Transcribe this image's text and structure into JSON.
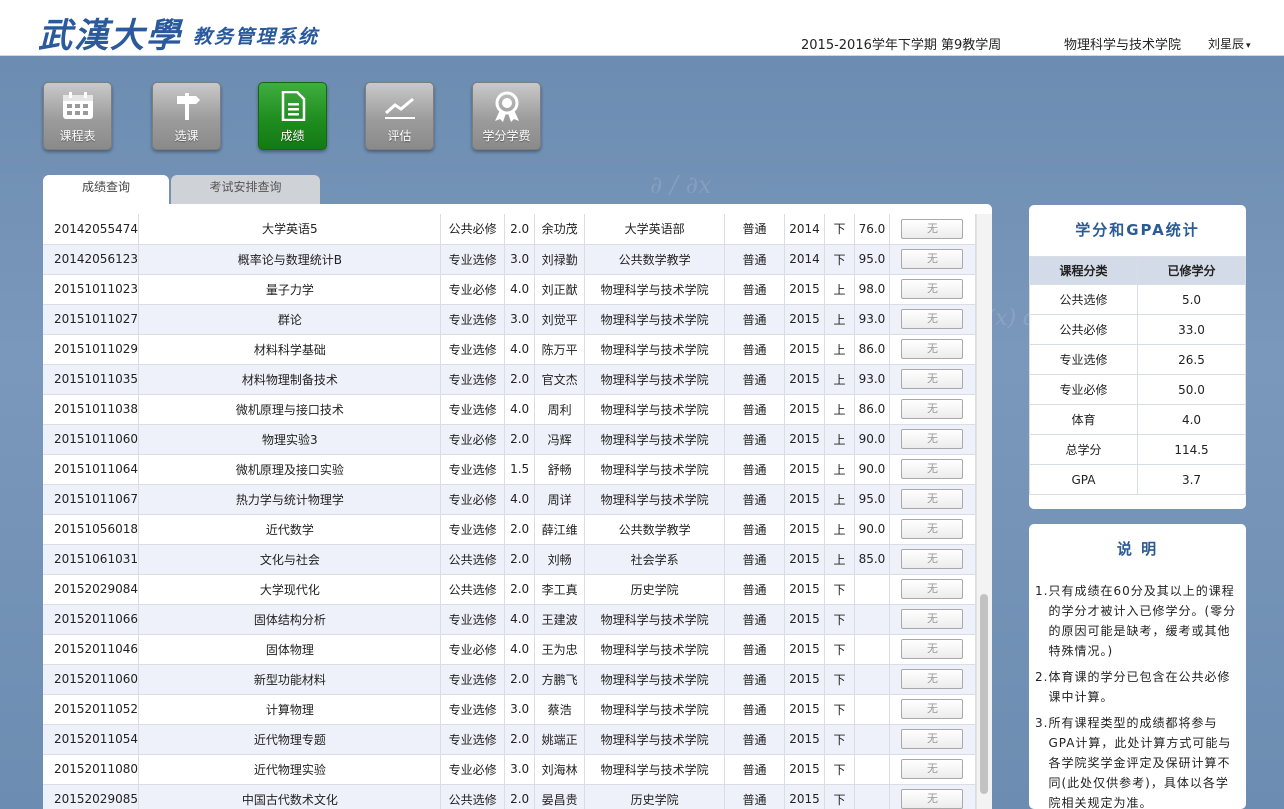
{
  "header": {
    "logo_main": "武漢大學",
    "logo_sub": "教务管理系统",
    "term": "2015-2016学年下学期 第9教学周",
    "college": "物理科学与技术学院",
    "user": "刘星辰",
    "user_caret": "▾"
  },
  "nav": [
    {
      "label": "课程表",
      "icon": "calendar-icon",
      "active": false
    },
    {
      "label": "选课",
      "icon": "signpost-icon",
      "active": false
    },
    {
      "label": "成绩",
      "icon": "document-icon",
      "active": true
    },
    {
      "label": "评估",
      "icon": "chart-line-icon",
      "active": false
    },
    {
      "label": "学分学费",
      "icon": "award-ribbon-icon",
      "active": false
    }
  ],
  "tabs": [
    {
      "label": "成绩查询",
      "active": true
    },
    {
      "label": "考试安排查询",
      "active": false
    }
  ],
  "grades": [
    [
      "20142055474",
      "大学英语5",
      "公共必修",
      "2.0",
      "余功茂",
      "大学英语部",
      "普通",
      "2014",
      "下",
      "76.0",
      "无"
    ],
    [
      "20142056123",
      "概率论与数理统计B",
      "专业选修",
      "3.0",
      "刘禄勤",
      "公共数学教学",
      "普通",
      "2014",
      "下",
      "95.0",
      "无"
    ],
    [
      "20151011023",
      "量子力学",
      "专业必修",
      "4.0",
      "刘正猷",
      "物理科学与技术学院",
      "普通",
      "2015",
      "上",
      "98.0",
      "无"
    ],
    [
      "20151011027",
      "群论",
      "专业选修",
      "3.0",
      "刘觉平",
      "物理科学与技术学院",
      "普通",
      "2015",
      "上",
      "93.0",
      "无"
    ],
    [
      "20151011029",
      "材料科学基础",
      "专业选修",
      "4.0",
      "陈万平",
      "物理科学与技术学院",
      "普通",
      "2015",
      "上",
      "86.0",
      "无"
    ],
    [
      "20151011035",
      "材料物理制备技术",
      "专业选修",
      "2.0",
      "官文杰",
      "物理科学与技术学院",
      "普通",
      "2015",
      "上",
      "93.0",
      "无"
    ],
    [
      "20151011038",
      "微机原理与接口技术",
      "专业选修",
      "4.0",
      "周利",
      "物理科学与技术学院",
      "普通",
      "2015",
      "上",
      "86.0",
      "无"
    ],
    [
      "20151011060",
      "物理实验3",
      "专业必修",
      "2.0",
      "冯辉",
      "物理科学与技术学院",
      "普通",
      "2015",
      "上",
      "90.0",
      "无"
    ],
    [
      "20151011064",
      "微机原理及接口实验",
      "专业选修",
      "1.5",
      "舒畅",
      "物理科学与技术学院",
      "普通",
      "2015",
      "上",
      "90.0",
      "无"
    ],
    [
      "20151011067",
      "热力学与统计物理学",
      "专业必修",
      "4.0",
      "周详",
      "物理科学与技术学院",
      "普通",
      "2015",
      "上",
      "95.0",
      "无"
    ],
    [
      "20151056018",
      "近代数学",
      "专业选修",
      "2.0",
      "薛江维",
      "公共数学教学",
      "普通",
      "2015",
      "上",
      "90.0",
      "无"
    ],
    [
      "20151061031",
      "文化与社会",
      "公共选修",
      "2.0",
      "刘畅",
      "社会学系",
      "普通",
      "2015",
      "上",
      "85.0",
      "无"
    ],
    [
      "20152029084",
      "大学现代化",
      "公共选修",
      "2.0",
      "李工真",
      "历史学院",
      "普通",
      "2015",
      "下",
      "",
      "无"
    ],
    [
      "20152011066",
      "固体结构分析",
      "专业选修",
      "4.0",
      "王建波",
      "物理科学与技术学院",
      "普通",
      "2015",
      "下",
      "",
      "无"
    ],
    [
      "20152011046",
      "固体物理",
      "专业必修",
      "4.0",
      "王为忠",
      "物理科学与技术学院",
      "普通",
      "2015",
      "下",
      "",
      "无"
    ],
    [
      "20152011060",
      "新型功能材料",
      "专业选修",
      "2.0",
      "方鹏飞",
      "物理科学与技术学院",
      "普通",
      "2015",
      "下",
      "",
      "无"
    ],
    [
      "20152011052",
      "计算物理",
      "专业选修",
      "3.0",
      "蔡浩",
      "物理科学与技术学院",
      "普通",
      "2015",
      "下",
      "",
      "无"
    ],
    [
      "20152011054",
      "近代物理专题",
      "专业选修",
      "2.0",
      "姚端正",
      "物理科学与技术学院",
      "普通",
      "2015",
      "下",
      "",
      "无"
    ],
    [
      "20152011080",
      "近代物理实验",
      "专业必修",
      "3.0",
      "刘海林",
      "物理科学与技术学院",
      "普通",
      "2015",
      "下",
      "",
      "无"
    ],
    [
      "20152029085",
      "中国古代数术文化",
      "公共选修",
      "2.0",
      "晏昌贵",
      "历史学院",
      "普通",
      "2015",
      "下",
      "",
      "无"
    ]
  ],
  "stats": {
    "title": "学分和GPA统计",
    "head": [
      "课程分类",
      "已修学分"
    ],
    "rows": [
      [
        "公共选修",
        "5.0"
      ],
      [
        "公共必修",
        "33.0"
      ],
      [
        "专业选修",
        "26.5"
      ],
      [
        "专业必修",
        "50.0"
      ],
      [
        "体育",
        "4.0"
      ],
      [
        "总学分",
        "114.5"
      ],
      [
        "GPA",
        "3.7"
      ]
    ]
  },
  "notes": {
    "title": "说 明",
    "items": [
      {
        "n": "1.",
        "text": "只有成绩在60分及其以上的课程的学分才被计入已修学分。(零分的原因可能是缺考，缓考或其他特殊情况。)"
      },
      {
        "n": "2.",
        "text": "体育课的学分已包含在公共必修课中计算。"
      },
      {
        "n": "3.",
        "text": "所有课程类型的成绩都将参与GPA计算，此处计算方式可能与各学院奖学金评定及保研计算不同(此处仅供参考)，具体以各学院相关规定为准。"
      }
    ]
  }
}
